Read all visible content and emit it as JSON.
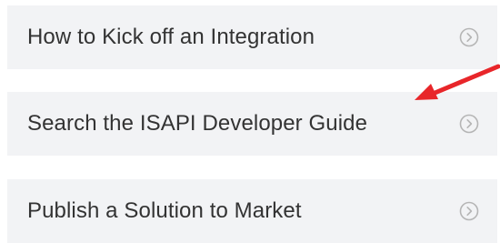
{
  "items": [
    {
      "label": "How to Kick off an Integration",
      "icon": "chevron-right-circle-icon"
    },
    {
      "label": "Search the ISAPI Developer Guide",
      "icon": "chevron-right-circle-icon"
    },
    {
      "label": "Publish a Solution to Market",
      "icon": "chevron-right-circle-icon"
    }
  ],
  "annotation": {
    "icon": "red-arrow-icon",
    "color": "#e8262a"
  },
  "colors": {
    "card_bg": "#f2f3f5",
    "text": "#333333",
    "icon": "#b5b5b5"
  }
}
